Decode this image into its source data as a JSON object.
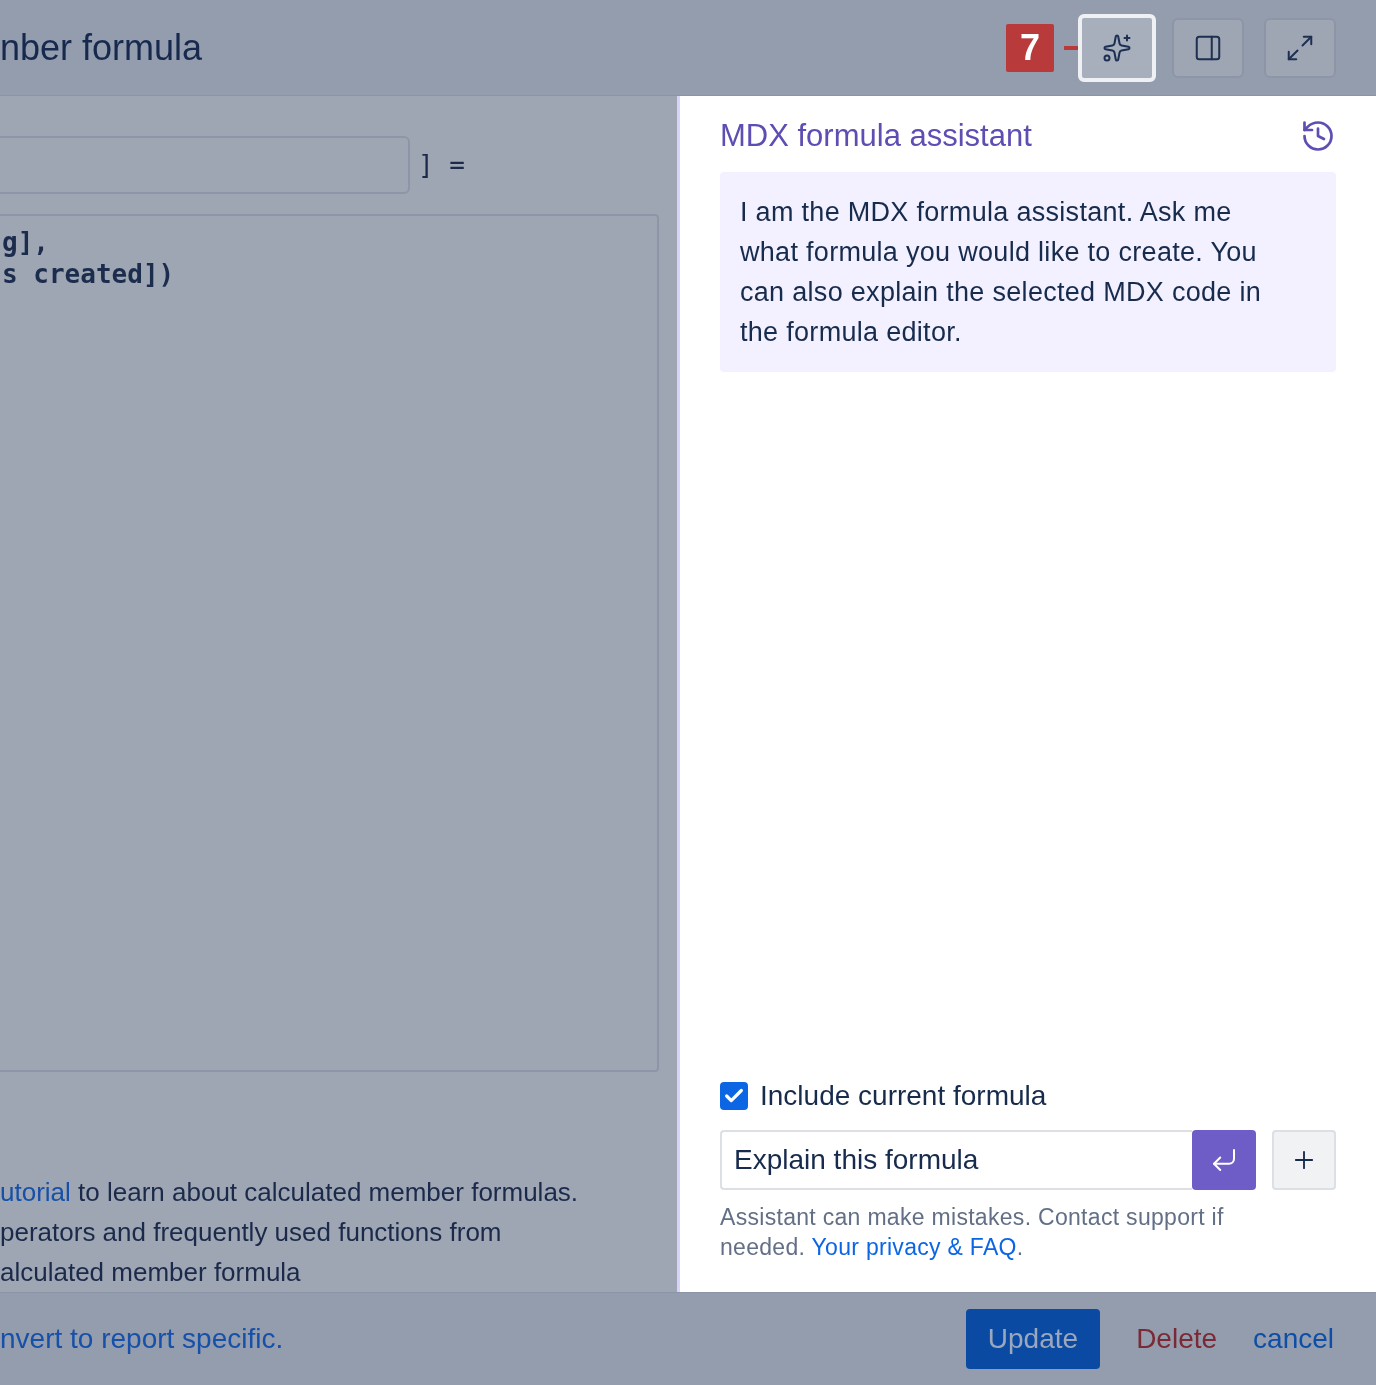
{
  "dialog_title": "nber formula",
  "toolbar": {
    "callout": "7",
    "buttons": [
      {
        "kind": "ai",
        "highlighted": true
      },
      {
        "kind": "panel",
        "highlighted": false
      },
      {
        "kind": "expand",
        "highlighted": false
      }
    ]
  },
  "editor": {
    "name_suffix": "] =",
    "code_lines": [
      "g],",
      "s created])"
    ]
  },
  "help": {
    "link": "utorial",
    "lines": [
      " to learn about calculated member formulas.",
      "perators and frequently used functions from",
      "alculated member formula"
    ]
  },
  "assistant": {
    "title": "MDX formula assistant",
    "message": "I am the MDX formula assistant. Ask me what formula you would like to create. You can also explain the selected MDX code in the formula editor.",
    "include_formula": {
      "label": "Include current formula",
      "checked": true
    },
    "prompt": {
      "value": "Explain this formula"
    },
    "disclaimer": {
      "text": "Assistant can make mistakes. Contact support if needed. ",
      "link": "Your privacy & FAQ",
      "suffix": "."
    }
  },
  "footer": {
    "link": "nvert to report specific.",
    "buttons": [
      {
        "kind": "primary",
        "label": "Update"
      },
      {
        "kind": "danger",
        "label": "Delete"
      },
      {
        "kind": "link",
        "label": "cancel"
      }
    ]
  }
}
